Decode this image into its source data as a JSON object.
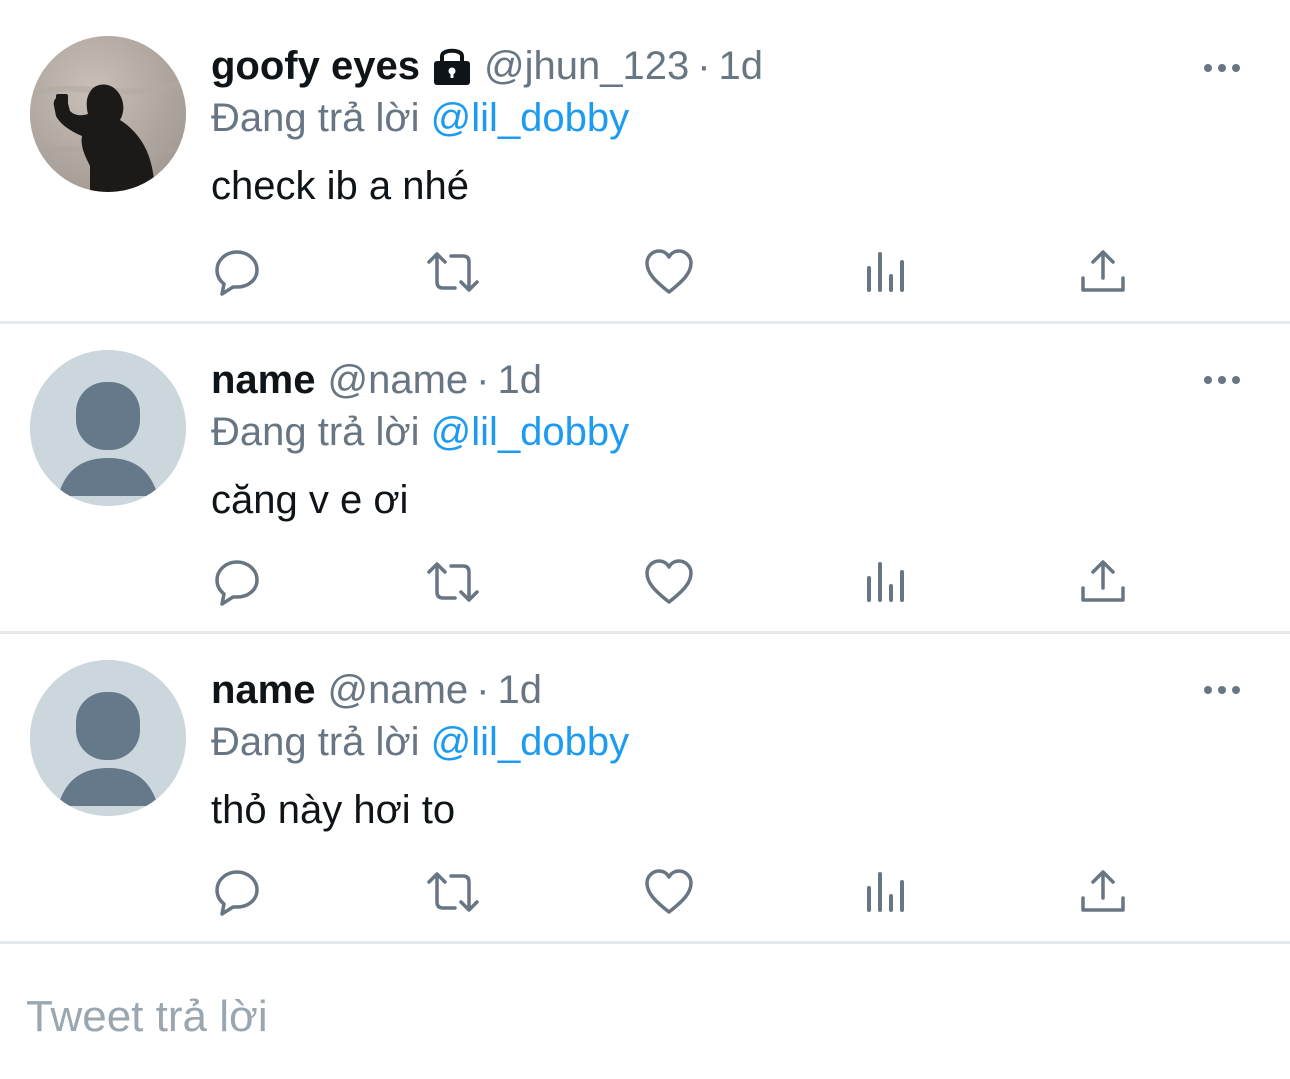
{
  "tweets": [
    {
      "display_name": "goofy eyes",
      "protected": true,
      "handle": "@jhun_123",
      "separator": "·",
      "time": "1d",
      "reply_prefix": "Đang trả lời",
      "reply_to": "@lil_dobby",
      "text": "check ib a nhé",
      "avatar": "photo-shadow-avatar"
    },
    {
      "display_name": "name",
      "protected": false,
      "handle": "@name",
      "separator": "·",
      "time": "1d",
      "reply_prefix": "Đang trả lời",
      "reply_to": "@lil_dobby",
      "text": "căng v e ơi",
      "avatar": "default-avatar"
    },
    {
      "display_name": "name",
      "protected": false,
      "handle": "@name",
      "separator": "·",
      "time": "1d",
      "reply_prefix": "Đang trả lời",
      "reply_to": "@lil_dobby",
      "text": "thỏ này hơi to",
      "avatar": "default-avatar"
    }
  ],
  "actions": [
    "reply-icon",
    "retweet-icon",
    "like-icon",
    "views-icon",
    "share-icon"
  ],
  "composer": {
    "placeholder": "Tweet trả lời"
  },
  "colors": {
    "text": "#0f1419",
    "secondary": "#687684",
    "accent": "#1d9bf0",
    "divider": "#e6e9eb",
    "default_avatar_bg": "#ccd6dd",
    "default_avatar_fg": "#66798a"
  }
}
